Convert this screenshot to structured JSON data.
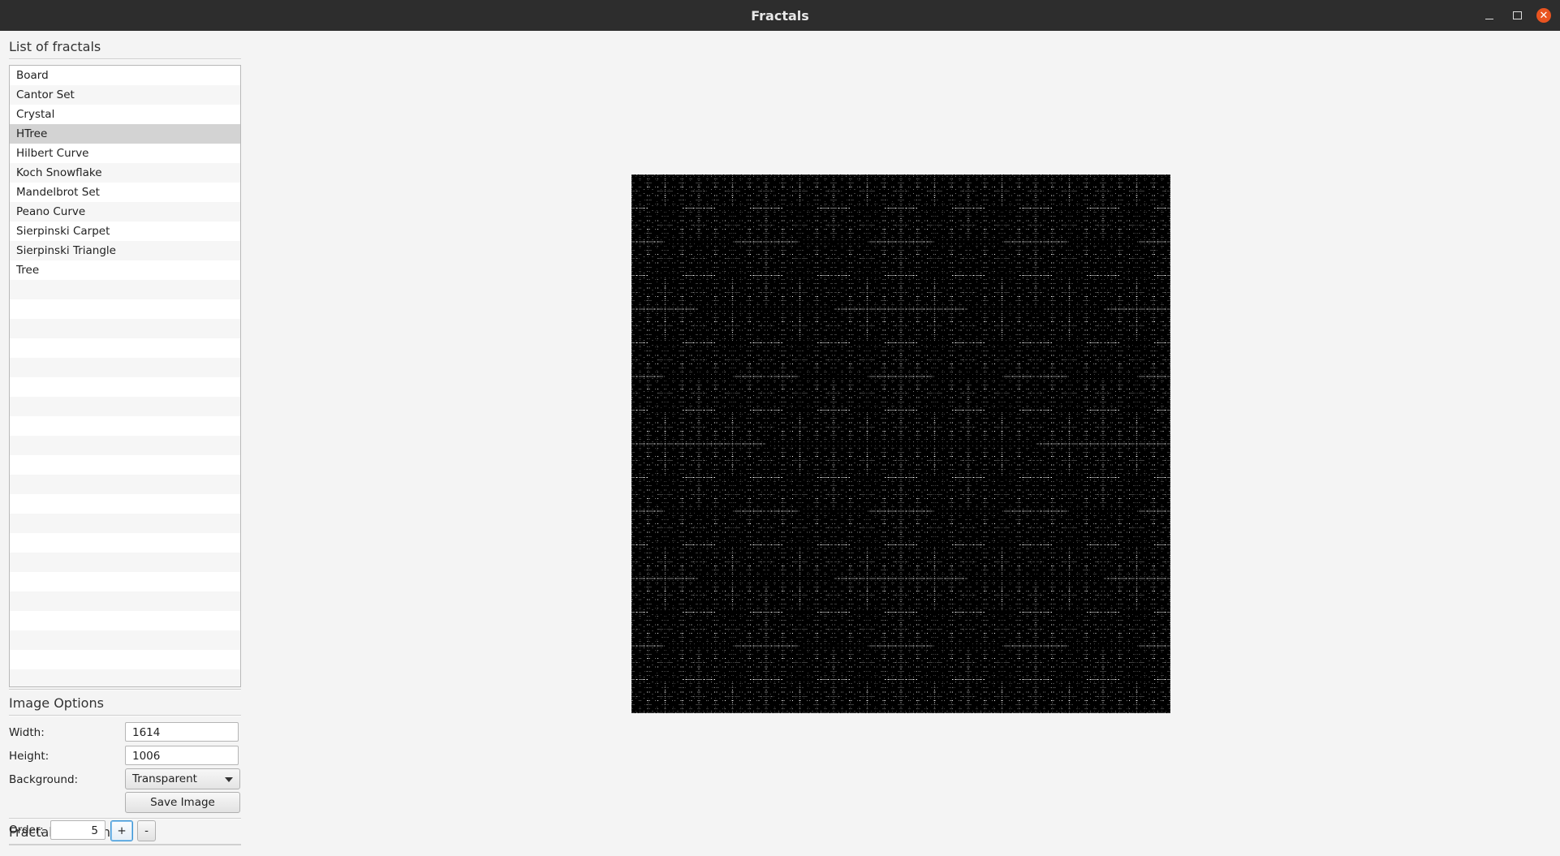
{
  "window": {
    "title": "Fractals"
  },
  "fractal_list": {
    "title": "List of fractals",
    "items": [
      "Board",
      "Cantor Set",
      "Crystal",
      "HTree",
      "Hilbert Curve",
      "Koch Snowflake",
      "Mandelbrot Set",
      "Peano Curve",
      "Sierpinski Carpet",
      "Sierpinski Triangle",
      "Tree"
    ],
    "selected": "HTree"
  },
  "image_options": {
    "title": "Image Options",
    "width_label": "Width:",
    "width_value": "1614",
    "height_label": "Height:",
    "height_value": "1006",
    "background_label": "Background:",
    "background_value": "Transparent",
    "save_label": "Save Image"
  },
  "fractal_options": {
    "title": "Fractal's Options",
    "order_label": "Order:",
    "order_value": "5",
    "plus_label": "+",
    "minus_label": "-"
  },
  "render": {
    "fractal": "HTree",
    "order": 5,
    "stroke_color": "#000000"
  }
}
